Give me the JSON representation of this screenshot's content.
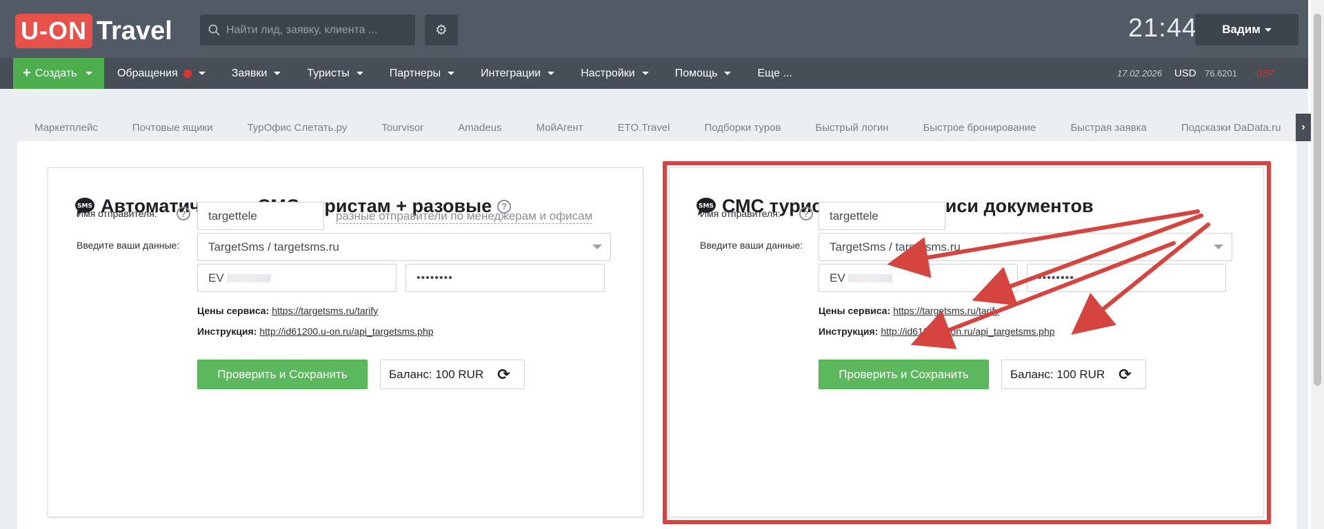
{
  "header": {
    "logo_box": "U-ON",
    "logo_text": "Travel",
    "search_placeholder": "Найти лид, заявку, клиента ...",
    "clock": "21:44",
    "user": "Вадим"
  },
  "nav": {
    "create": "Создать",
    "items": [
      "Обращения",
      "Заявки",
      "Туристы",
      "Партнеры",
      "Интеграции",
      "Настройки",
      "Помощь",
      "Еще ..."
    ],
    "rate_date": "17.02.2026",
    "rate_currency": "USD",
    "rate_value": "76.6201",
    "rate_diff": "-0.57"
  },
  "tabs": [
    "Маркетплейс",
    "Почтовые ящики",
    "ТурОфис Слетать.ру",
    "Tourvisor",
    "Amadeus",
    "МойАгент",
    "ETO.Travel",
    "Подборки туров",
    "Быстрый логин",
    "Быстрое бронирование",
    "Быстрая заявка",
    "Подсказки DaData.ru"
  ],
  "left_card": {
    "title": "Автоматические СМС туристам + разовые",
    "sender_label": "Имя отправителя:",
    "sender_value": "targettele",
    "sender_hint": "разные отправители по менеджерам и офисам",
    "data_label": "Введите ваши данные:",
    "provider": "TargetSms / targetsms.ru",
    "login_prefix": "EV",
    "password_mask": "••••••••",
    "prices_label": "Цены сервиса:",
    "prices_url": "https://targetsms.ru/tarify",
    "instr_label": "Инструкция:",
    "instr_url": "http://id61200.u-on.ru/api_targetsms.php",
    "save_button": "Проверить и Сохранить",
    "balance": "Баланс: 100 RUR"
  },
  "right_card": {
    "title": "СМС туристам при подписи документов",
    "sender_label": "Имя отправителя:",
    "sender_value": "targettele",
    "data_label": "Введите ваши данные:",
    "provider": "TargetSms / targetsms.ru",
    "login_prefix": "EV",
    "password_mask": "••••••••",
    "prices_label": "Цены сервиса:",
    "prices_url": "https://targetsms.ru/tarify",
    "instr_label": "Инструкция:",
    "instr_url": "http://id61200.u-on.ru/api_targetsms.php",
    "save_button": "Проверить и Сохранить",
    "balance": "Баланс: 100 RUR"
  },
  "colors": {
    "topbar": "#525a66",
    "navbar": "#474e58",
    "accent_green": "#5cb85c",
    "highlight_red": "#d6443f",
    "logo_red": "#e8504a"
  }
}
